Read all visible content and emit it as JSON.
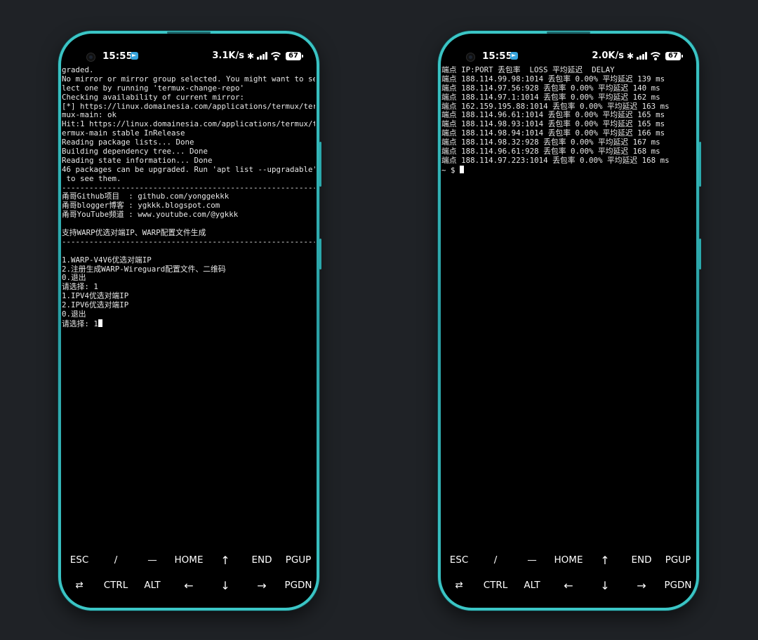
{
  "statusbar_left": {
    "time": "15:55",
    "net_speed": "3.1K/s",
    "battery": "67"
  },
  "statusbar_right": {
    "time": "15:55",
    "net_speed": "2.0K/s",
    "battery": "67"
  },
  "left_terminal": [
    "graded.",
    "No mirror or mirror group selected. You might want to se",
    "lect one by running 'termux-change-repo'",
    "Checking availability of current mirror:",
    "[*] https://linux.domainesia.com/applications/termux/ter",
    "mux-main: ok",
    "Hit:1 https://linux.domainesia.com/applications/termux/t",
    "ermux-main stable InRelease",
    "Reading package lists... Done",
    "Building dependency tree... Done",
    "Reading state information... Done",
    "46 packages can be upgraded. Run 'apt list --upgradable'",
    " to see them.",
    "--------------------------------------------------------",
    "甬哥Github项目  : github.com/yonggekkk",
    "甬哥blogger博客 : ygkkk.blogspot.com",
    "甬哥YouTube频道 : www.youtube.com/@ygkkk",
    "",
    "支持WARP优选对端IP、WARP配置文件生成",
    "--------------------------------------------------------",
    "",
    "1.WARP-V4V6优选对端IP",
    "2.注册生成WARP-Wireguard配置文件、二维码",
    "0.退出",
    "请选择: 1",
    "1.IPV4优选对端IP",
    "2.IPV6优选对端IP",
    "0.退出",
    "请选择: 1"
  ],
  "right_terminal": [
    "端点 IP:PORT 丢包率  LOSS 平均延迟  DELAY",
    "端点 188.114.99.98:1014 丢包率 0.00% 平均延迟 139 ms",
    "端点 188.114.97.56:928 丢包率 0.00% 平均延迟 140 ms",
    "端点 188.114.97.1:1014 丢包率 0.00% 平均延迟 162 ms",
    "端点 162.159.195.88:1014 丢包率 0.00% 平均延迟 163 ms",
    "端点 188.114.96.61:1014 丢包率 0.00% 平均延迟 165 ms",
    "端点 188.114.98.93:1014 丢包率 0.00% 平均延迟 165 ms",
    "端点 188.114.98.94:1014 丢包率 0.00% 平均延迟 166 ms",
    "端点 188.114.98.32:928 丢包率 0.00% 平均延迟 167 ms",
    "端点 188.114.96.61:928 丢包率 0.00% 平均延迟 168 ms",
    "端点 188.114.97.223:1014 丢包率 0.00% 平均延迟 168 ms",
    "~ $ "
  ],
  "extra_keys": {
    "row1": [
      "ESC",
      "/",
      "—",
      "HOME",
      "↑",
      "END",
      "PGUP"
    ],
    "row2": [
      "⇄",
      "CTRL",
      "ALT",
      "←",
      "↓",
      "→",
      "PGDN"
    ]
  },
  "icons": {
    "telegram": "telegram-icon",
    "bluetooth": "bluetooth-icon",
    "signal": "signal-icon",
    "wifi": "wifi-icon",
    "battery": "battery-icon"
  }
}
